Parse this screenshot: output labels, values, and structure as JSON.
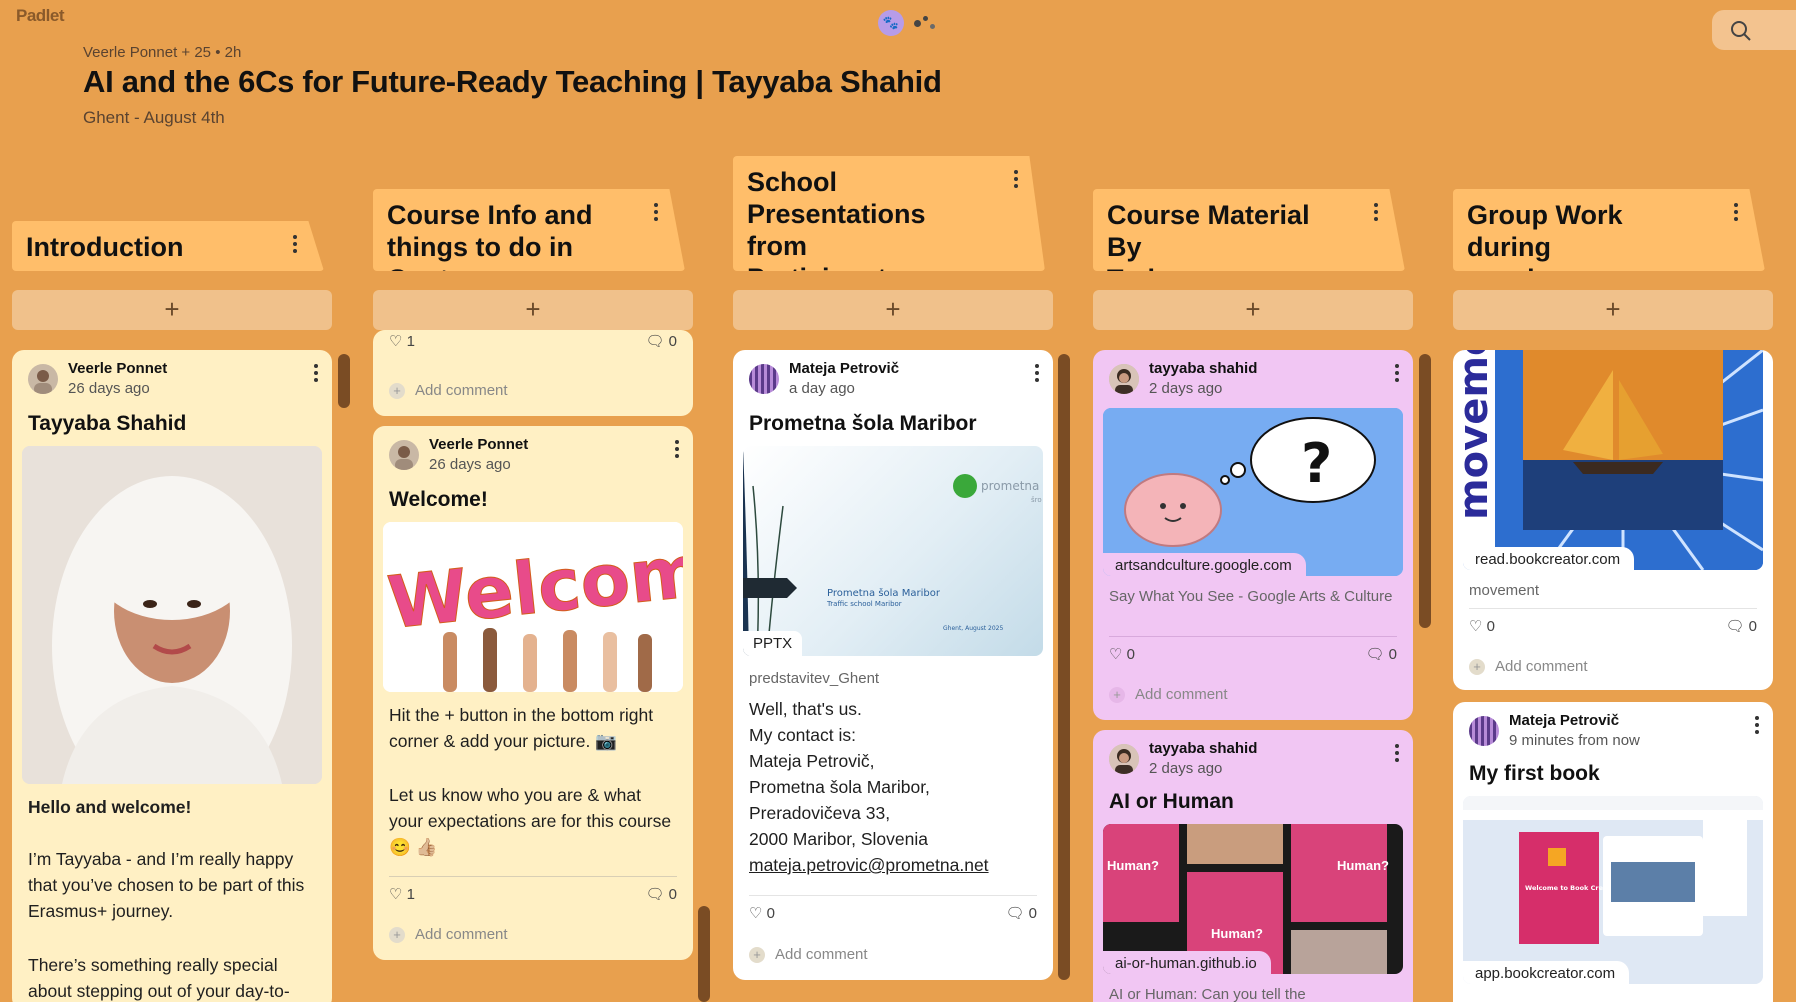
{
  "app": {
    "logo": "Padlet",
    "avatar_initial": "🐾"
  },
  "header": {
    "meta": "Veerle Ponnet + 25 • 2h",
    "title": "AI and the 6Cs for Future-Ready Teaching | Tayyaba Shahid",
    "subtitle": "Ghent - August 4th"
  },
  "columns": [
    {
      "title_l1": "Introduction",
      "title_l2": "",
      "title_l3": ""
    },
    {
      "title_l1": "Course Info and",
      "title_l2": "things to do in Gent",
      "title_l3": ""
    },
    {
      "title_l1": "School",
      "title_l2": "Presentations from",
      "title_l3": "Participants"
    },
    {
      "title_l1": "Course Material By",
      "title_l2": "Trainer",
      "title_l3": ""
    },
    {
      "title_l1": "Group Work during",
      "title_l2": "session",
      "title_l3": ""
    }
  ],
  "add_label": "+",
  "add_comment_label": "Add comment",
  "cards": {
    "intro": {
      "author": "Veerle Ponnet",
      "time": "26 days ago",
      "title": "Tayyaba Shahid",
      "heading": "Hello and welcome!",
      "p1": "I’m Tayyaba - and I’m really happy that you’ve chosen to be part of this Erasmus+ journey.",
      "p2": "There’s something really special about stepping out of your day-to-"
    },
    "course_top": {
      "likes": "1",
      "comments": "0"
    },
    "welcome": {
      "author": "Veerle Ponnet",
      "time": "26 days ago",
      "title": "Welcome!",
      "image_word": "Welcome",
      "p1": "Hit the + button in the bottom right corner & add your picture. 📷",
      "p2": "Let us know who you are & what your expectations are for this course 😊 👍🏼",
      "likes": "1",
      "comments": "0"
    },
    "school": {
      "author": "Mateja Petrovič",
      "time": "a day ago",
      "title": "Prometna šola Maribor",
      "slide_logo": "prometna š",
      "slide_sub": "šro",
      "slide_title": "Prometna šola Maribor",
      "slide_subtitle": "Traffic school Maribor",
      "slide_date": "Ghent, August 2025",
      "file_type": "PPTX",
      "file_name": "predstavitev_Ghent",
      "lines": [
        "Well, that's us.",
        "My contact is:",
        "Mateja Petrovič,",
        "Prometna šola Maribor,",
        "Preradovičeva 33,",
        "2000 Maribor, Slovenia"
      ],
      "email": "mateja.petrovic@prometna.net",
      "likes": "0",
      "comments": "0"
    },
    "arts": {
      "author": "tayyaba shahid",
      "time": "2 days ago",
      "domain": "artsandculture.google.com",
      "desc": "Say What You See - Google Arts & Culture",
      "likes": "0",
      "comments": "0"
    },
    "ai_human": {
      "author": "tayyaba shahid",
      "time": "2 days ago",
      "title": "AI or Human",
      "tile_label": "Human?",
      "domain": "ai-or-human.github.io",
      "desc": "AI or Human: Can you tell the"
    },
    "movement": {
      "image_text": "moveme",
      "domain": "read.bookcreator.com",
      "desc": "movement",
      "likes": "0",
      "comments": "0"
    },
    "book": {
      "author": "Mateja Petrovič",
      "time": "9 minutes from now",
      "title": "My first book",
      "book_cover": "Welcome to Book Creator",
      "domain": "app.bookcreator.com"
    }
  }
}
